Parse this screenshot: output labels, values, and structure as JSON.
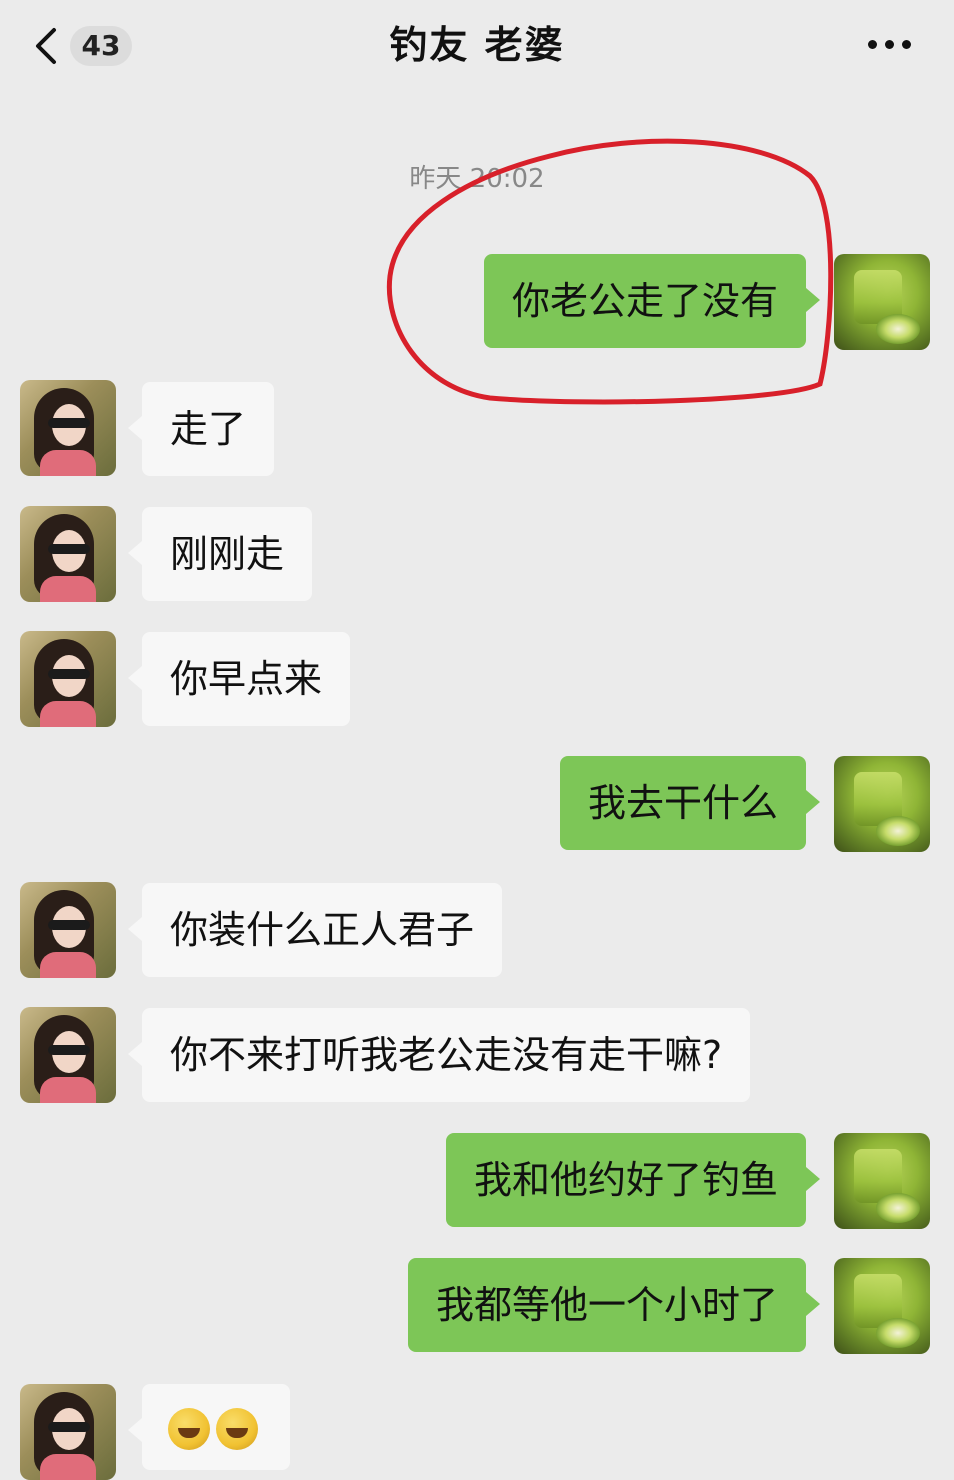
{
  "header": {
    "unread_count": "43",
    "title": "钓友  老婆",
    "back_icon": "chevron-left-icon",
    "more_icon": "more-dots-icon"
  },
  "timestamp": "昨天 20:02",
  "annotation_color": "#d8202a",
  "messages": [
    {
      "sender": "me",
      "text": "你老公走了没有"
    },
    {
      "sender": "peer",
      "text": "走了"
    },
    {
      "sender": "peer",
      "text": "刚刚走"
    },
    {
      "sender": "peer",
      "text": "你早点来"
    },
    {
      "sender": "me",
      "text": "我去干什么"
    },
    {
      "sender": "peer",
      "text": "你装什么正人君子"
    },
    {
      "sender": "peer",
      "text": "你不来打听我老公走没有走干嘛?"
    },
    {
      "sender": "me",
      "text": "我和他约好了钓鱼"
    },
    {
      "sender": "me",
      "text": "我都等他一个小时了"
    },
    {
      "sender": "peer",
      "text": "",
      "emojis": [
        "facepalm-emoji",
        "facepalm-emoji"
      ]
    }
  ],
  "colors": {
    "self_bubble": "#7dc657",
    "peer_bubble": "#f7f7f7",
    "background": "#ebebeb"
  }
}
